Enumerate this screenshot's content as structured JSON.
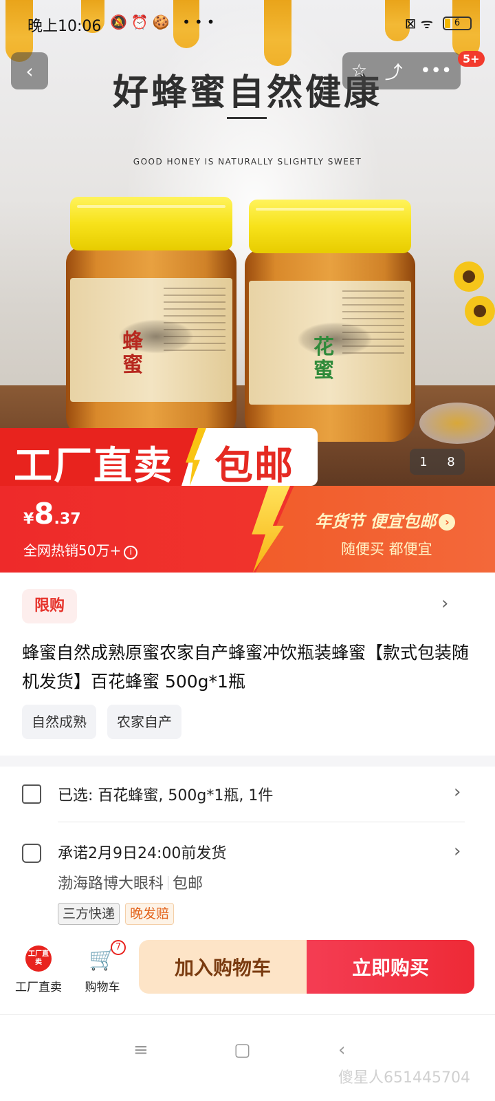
{
  "status_bar": {
    "time": "晚上10:06",
    "left_icons": "🔕⏰🍪 •••",
    "right_icons": "⊠ ᯤ",
    "battery": "6"
  },
  "nav": {
    "back": "‹",
    "favorite": "☆",
    "share": "⤴",
    "more": "•••",
    "message_badge": "5+"
  },
  "hero": {
    "headline": "好蜂蜜自然健康",
    "subline": "GOOD HONEY IS NATURALLY SLIGHTLY SWEET",
    "jar_left_name": "蜂蜜",
    "jar_right_name": "花蜜",
    "banner_left": "工厂直卖",
    "banner_right": "包邮",
    "image_index": "1",
    "image_total": "8"
  },
  "price_bar": {
    "currency": "¥",
    "price_int": "8",
    "price_dec": ".37",
    "sold_text": "全网热销50万+",
    "info_icon": "i",
    "promo_title": "年货节 便宜包邮",
    "promo_arrow": "›",
    "promo_sub": "随便买 都便宜"
  },
  "product": {
    "limit_tag": "限购",
    "title": "蜂蜜自然成熟原蜜农家自产蜂蜜冲饮瓶装蜂蜜【款式包装随机发货】百花蜂蜜 500g*1瓶",
    "tags": [
      "自然成熟",
      "农家自产"
    ]
  },
  "details": {
    "selected": "已选: 百花蜂蜜, 500g*1瓶, 1件",
    "shipping": "承诺2月9日24:00前发货",
    "location": "渤海路博大眼科",
    "free_shipping": "包邮",
    "tag_express": "三方快递",
    "tag_late": "晚发赔",
    "chevron": "›"
  },
  "bottom_bar": {
    "factory_icon_text": "工厂直卖",
    "factory_label": "工厂直卖",
    "cart_label": "购物车",
    "cart_count": "7",
    "add_to_cart": "加入购物车",
    "buy_now": "立即购买"
  },
  "system_nav": {
    "menu": "≡",
    "home": "▢",
    "back": "‹"
  },
  "watermark": "傻星人651445704",
  "colors": {
    "brand_red": "#e8231e",
    "buy_button": "#f43d53",
    "cart_button_bg": "#fde4c7",
    "promo_text": "#fff3c4"
  }
}
